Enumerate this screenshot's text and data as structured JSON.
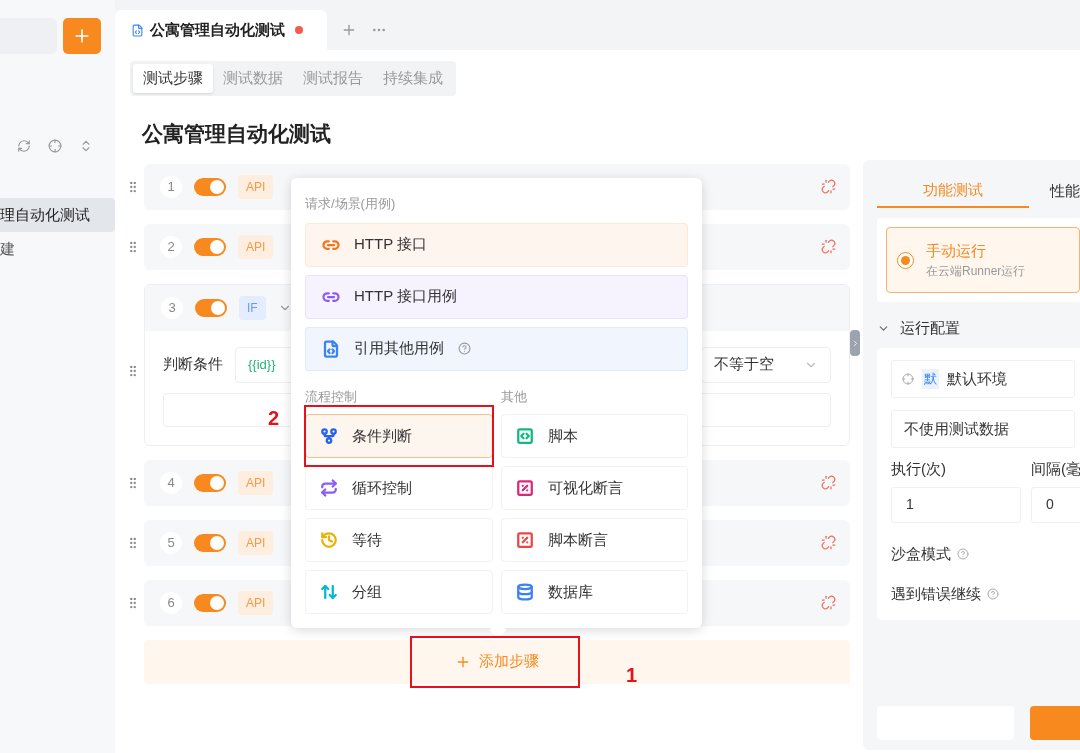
{
  "sidebar": {
    "items": [
      {
        "label": "理自动化测试",
        "selected": true
      },
      {
        "label": "建",
        "selected": false
      }
    ]
  },
  "doc_tabs": [
    {
      "title": "公寓管理自动化测试",
      "unsaved": true
    }
  ],
  "sub_tabs": [
    {
      "label": "测试步骤",
      "selected": true
    },
    {
      "label": "测试数据",
      "selected": false
    },
    {
      "label": "测试报告",
      "selected": false
    },
    {
      "label": "持续集成",
      "selected": false
    }
  ],
  "page_title": "公寓管理自动化测试",
  "steps": [
    {
      "number": "1",
      "enabled": true,
      "kind": "api",
      "tag": "API"
    },
    {
      "number": "2",
      "enabled": true,
      "kind": "api",
      "tag": "API"
    },
    {
      "number": "3",
      "enabled": true,
      "kind": "if",
      "tag": "IF",
      "expanded": true,
      "condition": {
        "label": "判断条件",
        "variable": "{{id}}",
        "operator": "不等于空"
      }
    },
    {
      "number": "4",
      "enabled": true,
      "kind": "api",
      "tag": "API"
    },
    {
      "number": "5",
      "enabled": true,
      "kind": "api",
      "tag": "API"
    },
    {
      "number": "6",
      "enabled": true,
      "kind": "api",
      "tag": "API"
    }
  ],
  "add_step": {
    "label": "添加步骤"
  },
  "popup": {
    "top_section": {
      "title": "请求/场景(用例)",
      "items": [
        {
          "label": "HTTP 接口",
          "kind": "http",
          "color": "#f97316",
          "help": false
        },
        {
          "label": "HTTP 接口用例",
          "kind": "http-case",
          "color": "#8b5cf6",
          "help": false
        },
        {
          "label": "引用其他用例",
          "kind": "ref-case",
          "color": "#3b82f6",
          "help": true
        }
      ]
    },
    "columns": [
      {
        "title": "流程控制",
        "items": [
          {
            "label": "条件判断",
            "kind": "condition",
            "color": "#2563eb",
            "selected": true
          },
          {
            "label": "循环控制",
            "kind": "loop",
            "color": "#8b5cf6",
            "selected": false
          },
          {
            "label": "等待",
            "kind": "wait",
            "color": "#eab308",
            "selected": false
          },
          {
            "label": "分组",
            "kind": "group",
            "color": "#06b6d4",
            "selected": false
          }
        ]
      },
      {
        "title": "其他",
        "items": [
          {
            "label": "脚本",
            "kind": "script",
            "color": "#10b981",
            "selected": false
          },
          {
            "label": "可视化断言",
            "kind": "visual-assert",
            "color": "#db2777",
            "selected": false
          },
          {
            "label": "脚本断言",
            "kind": "script-assert",
            "color": "#ef4444",
            "selected": false
          },
          {
            "label": "数据库",
            "kind": "database",
            "color": "#3b82f6",
            "selected": false
          }
        ]
      }
    ]
  },
  "callouts": [
    {
      "label": "2"
    },
    {
      "label": "1"
    }
  ],
  "run_panel": {
    "tabs": [
      {
        "label": "功能测试",
        "selected": true
      },
      {
        "label": "性能",
        "selected": false
      }
    ],
    "run_mode": {
      "title": "手动运行",
      "subtitle": "在云端Runner运行",
      "selected": true
    },
    "config_title": "运行配置",
    "config_expanded": true,
    "environment": {
      "badge": "默",
      "label": "默认环境"
    },
    "test_data": "不使用测试数据",
    "fields": [
      {
        "label": "执行(次)",
        "value": "1"
      },
      {
        "label": "间隔(毫",
        "value": "0"
      }
    ],
    "options": [
      {
        "label": "沙盒模式"
      },
      {
        "label": "遇到错误继续"
      }
    ]
  }
}
